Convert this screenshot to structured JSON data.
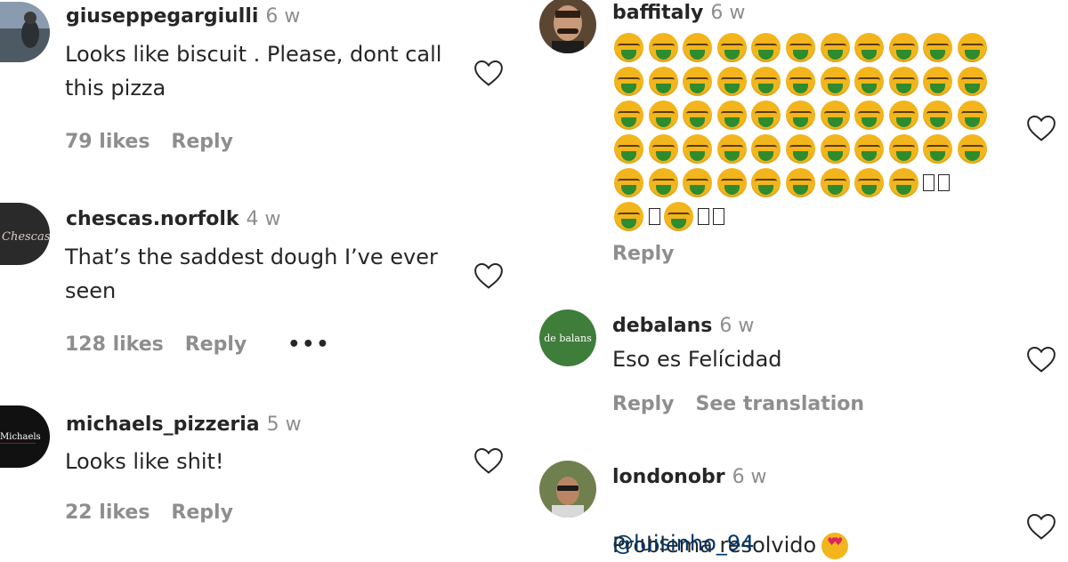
{
  "comments_left": [
    {
      "username": "giuseppegargiulli",
      "time": "6 w",
      "text": "Looks like biscuit . Please, dont call\nthis pizza",
      "likes": "79 likes",
      "reply": "Reply"
    },
    {
      "username": "chescas.norfolk",
      "time": "4 w",
      "text": "That’s the saddest dough I’ve ever\nseen",
      "likes": "128 likes",
      "reply": "Reply",
      "more": "•••"
    },
    {
      "username": "michaels_pizzeria",
      "time": "5 w",
      "text": "Looks like shit!",
      "likes": "22 likes",
      "reply": "Reply"
    }
  ],
  "comments_right": [
    {
      "username": "baffitaly",
      "time": "6 w",
      "emoji": "nauseated-face",
      "reply": "Reply"
    },
    {
      "username": "debalans",
      "avatar_text": "de balans",
      "time": "6 w",
      "text": "Eso es Felícidad",
      "reply": "Reply",
      "see_translation": "See translation"
    },
    {
      "username": "londonobr",
      "time": "6 w",
      "text": "Problema resolvido",
      "emoji": "heart-eyes",
      "mention": "@luisinho_94"
    }
  ],
  "avatar_labels": {
    "chescas": "Chescas",
    "michaels": "Michaels"
  },
  "colors": {
    "text": "#262626",
    "secondary": "#8e8e8e",
    "mention": "#00376b",
    "emoji_face": "#f2b51c",
    "emoji_green": "#2e8b2e"
  }
}
